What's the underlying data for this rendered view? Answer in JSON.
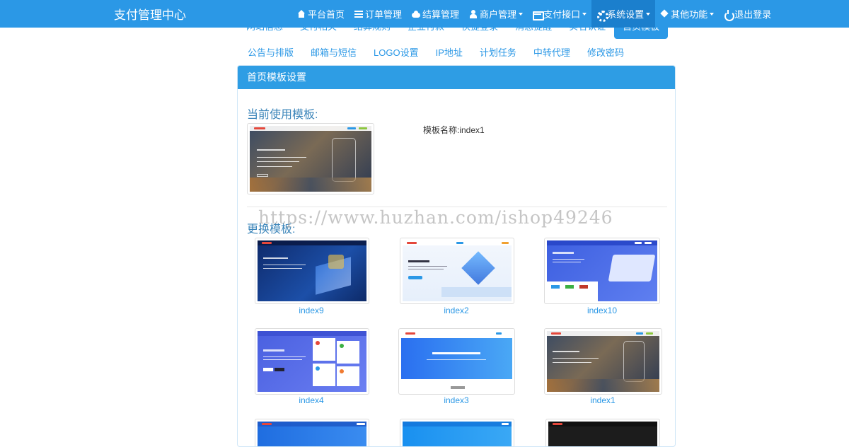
{
  "navbar": {
    "brand": "支付管理中心",
    "items": [
      {
        "label": "平台首页",
        "icon": "home-icon"
      },
      {
        "label": "订单管理",
        "icon": "list-icon"
      },
      {
        "label": "结算管理",
        "icon": "cloud-icon"
      },
      {
        "label": "商户管理",
        "icon": "user-icon",
        "dropdown": true
      },
      {
        "label": "支付接口",
        "icon": "credit-card-icon",
        "dropdown": true
      },
      {
        "label": "系统设置",
        "icon": "gear-icon",
        "dropdown": true,
        "active": true
      },
      {
        "label": "其他功能",
        "icon": "cube-icon",
        "dropdown": true
      },
      {
        "label": "退出登录",
        "icon": "power-icon"
      }
    ]
  },
  "tabs": {
    "row1": [
      "网站信息",
      "支付相关",
      "结算规则",
      "企业付款",
      "快捷登录",
      "消息提醒",
      "实名认证",
      "首页模板"
    ],
    "row2": [
      "公告与排版",
      "邮箱与短信",
      "LOGO设置",
      "IP地址",
      "计划任务",
      "中转代理",
      "修改密码"
    ],
    "active": "首页模板"
  },
  "panel": {
    "heading": "首页模板设置",
    "current_title": "当前使用模板:",
    "template_name_label": "模板名称:index1",
    "more_title": "更换模板:"
  },
  "templates": [
    "index9",
    "index2",
    "index10",
    "index4",
    "index3",
    "index1"
  ],
  "watermark": "https://www.huzhan.com/ishop49246",
  "colors": {
    "accent": "#2b98e6",
    "nav_active": "#1b7fcd"
  }
}
